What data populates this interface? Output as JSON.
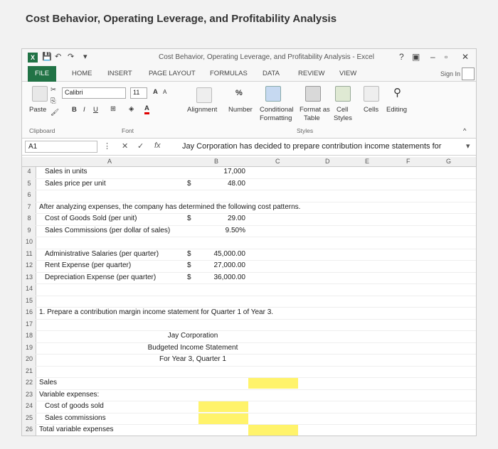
{
  "page_heading": "Cost Behavior, Operating Leverage, and Profitability Analysis",
  "window": {
    "title": "Cost Behavior, Operating Leverage, and Profitability Analysis - Excel",
    "help": "?",
    "minimize": "–",
    "restore": "▫",
    "close": "✕"
  },
  "tabs": [
    "FILE",
    "HOME",
    "INSERT",
    "PAGE LAYOUT",
    "FORMULAS",
    "DATA",
    "REVIEW",
    "VIEW"
  ],
  "sign_in": "Sign In",
  "ribbon": {
    "font_name": "Calibri",
    "font_size": "11",
    "paste": "Paste",
    "clipboard": "Clipboard",
    "font_group": "Font",
    "bold": "B",
    "italic": "I",
    "underline": "U",
    "grow": "A",
    "shrink": "A",
    "font_color": "A",
    "alignment": "Alignment",
    "number": "Number",
    "percent": "%",
    "conditional": "Conditional",
    "formatting": "Formatting",
    "format_as": "Format as",
    "table": "Table",
    "cell": "Cell",
    "styles_btn": "Styles",
    "styles_group": "Styles",
    "cells": "Cells",
    "editing": "Editing"
  },
  "formula_bar": {
    "name_box": "A1",
    "cancel": "✕",
    "enter": "✓",
    "fx": "fx",
    "value": "Jay Corporation has decided to prepare contribution income statements for"
  },
  "columns": [
    "A",
    "B",
    "C",
    "D",
    "E",
    "F",
    "G"
  ],
  "rows": [
    {
      "n": "4",
      "a": "Sales in units",
      "b_sym": "",
      "b": "17,000"
    },
    {
      "n": "5",
      "a": "Sales price per unit",
      "b_sym": "$",
      "b": "48.00"
    },
    {
      "n": "6",
      "a": "",
      "b_sym": "",
      "b": ""
    },
    {
      "n": "7",
      "a": "After analyzing expenses, the company has determined the following cost patterns.",
      "b_sym": "",
      "b": "",
      "flush": true
    },
    {
      "n": "8",
      "a": "Cost of Goods Sold (per unit)",
      "b_sym": "$",
      "b": "29.00"
    },
    {
      "n": "9",
      "a": "Sales Commissions (per dollar of sales)",
      "b_sym": "",
      "b": "9.50%"
    },
    {
      "n": "10",
      "a": "",
      "b_sym": "",
      "b": ""
    },
    {
      "n": "11",
      "a": "Administrative Salaries (per quarter)",
      "b_sym": "$",
      "b": "45,000.00"
    },
    {
      "n": "12",
      "a": "Rent Expense (per quarter)",
      "b_sym": "$",
      "b": "27,000.00"
    },
    {
      "n": "13",
      "a": "Depreciation Expense (per quarter)",
      "b_sym": "$",
      "b": "36,000.00"
    },
    {
      "n": "14",
      "a": "",
      "b_sym": "",
      "b": ""
    },
    {
      "n": "15",
      "a": "",
      "b_sym": "",
      "b": ""
    },
    {
      "n": "16",
      "a": "1. Prepare a contribution margin income statement for Quarter 1 of Year 3.",
      "b_sym": "",
      "b": "",
      "flush": true
    },
    {
      "n": "17",
      "a": "",
      "b_sym": "",
      "b": ""
    },
    {
      "n": "18",
      "center": "Jay Corporation"
    },
    {
      "n": "19",
      "center": "Budgeted Income Statement"
    },
    {
      "n": "20",
      "center": "For Year 3, Quarter 1"
    },
    {
      "n": "21",
      "a": "",
      "b_sym": "",
      "b": ""
    },
    {
      "n": "22",
      "a": "Sales",
      "flush": true,
      "hl": "c"
    },
    {
      "n": "23",
      "a": "Variable expenses:",
      "flush": true
    },
    {
      "n": "24",
      "a": "Cost of goods sold",
      "hl": "b"
    },
    {
      "n": "25",
      "a": "Sales commissions",
      "hl": "b"
    },
    {
      "n": "26",
      "a": "Total variable expenses",
      "flush": true,
      "hl": "c"
    }
  ],
  "colors": {
    "excel_green": "#217346",
    "highlight": "#fff36b"
  }
}
